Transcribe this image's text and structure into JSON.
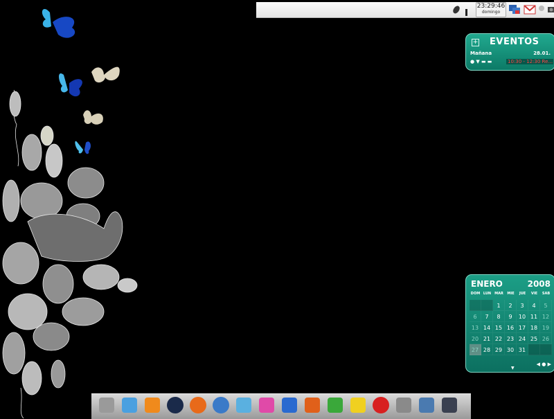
{
  "panel": {
    "clock_time": "23:29:46",
    "clock_day": "domingo",
    "tray_icons": [
      "feather-icon",
      "network-monitor-icon",
      "gmail-icon",
      "status-dot-icon",
      "camera-icon"
    ]
  },
  "events": {
    "title": "EVENTOS",
    "day_label": "Mañana",
    "date": "28.01.",
    "event_text": "10:30 - 12:30 Re..."
  },
  "calendar": {
    "month": "ENERO",
    "year": "2008",
    "weekdays": [
      "DOM",
      "LUN",
      "MAR",
      "MIE",
      "JUE",
      "VIE",
      "SAB"
    ],
    "weeks": [
      [
        "",
        "",
        "1",
        "2",
        "3",
        "4",
        "5"
      ],
      [
        "6",
        "7",
        "8",
        "9",
        "10",
        "11",
        "12"
      ],
      [
        "13",
        "14",
        "15",
        "16",
        "17",
        "18",
        "19"
      ],
      [
        "20",
        "21",
        "22",
        "23",
        "24",
        "25",
        "26"
      ],
      [
        "27",
        "28",
        "29",
        "30",
        "31",
        "",
        ""
      ]
    ]
  },
  "dock": {
    "apps": [
      "file-cabinet-icon",
      "itunes-icon",
      "vlc-icon",
      "clock-app-icon",
      "firefox-icon",
      "thunderbird-icon",
      "paint-icon",
      "flower-app-icon",
      "word-icon",
      "powerpoint-icon",
      "excel-icon",
      "banana-icon",
      "flame-app-icon",
      "trash-icon",
      "screen-icon",
      "square-icon"
    ]
  }
}
